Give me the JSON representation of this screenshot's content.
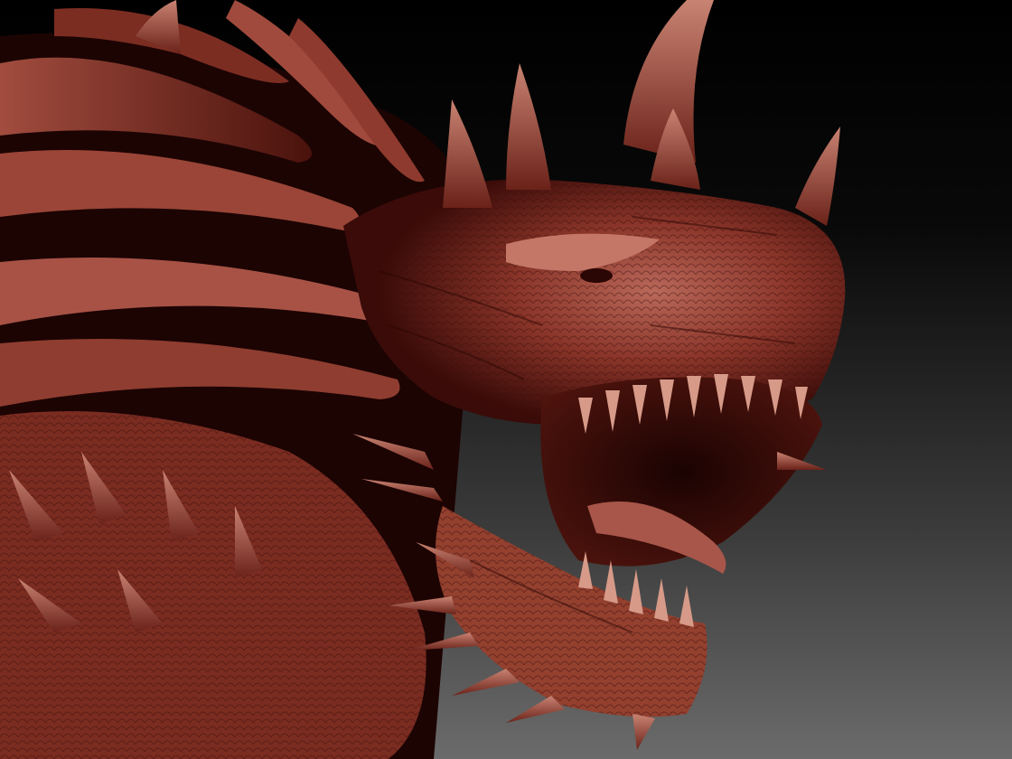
{
  "render": {
    "colors": {
      "background_top": "#000000",
      "background_bottom": "#6b6b6b",
      "clay_highlight": "#c97a6a",
      "clay_mid": "#8e3a2e",
      "clay_shadow": "#3a0b08",
      "clay_deep": "#170302"
    }
  }
}
